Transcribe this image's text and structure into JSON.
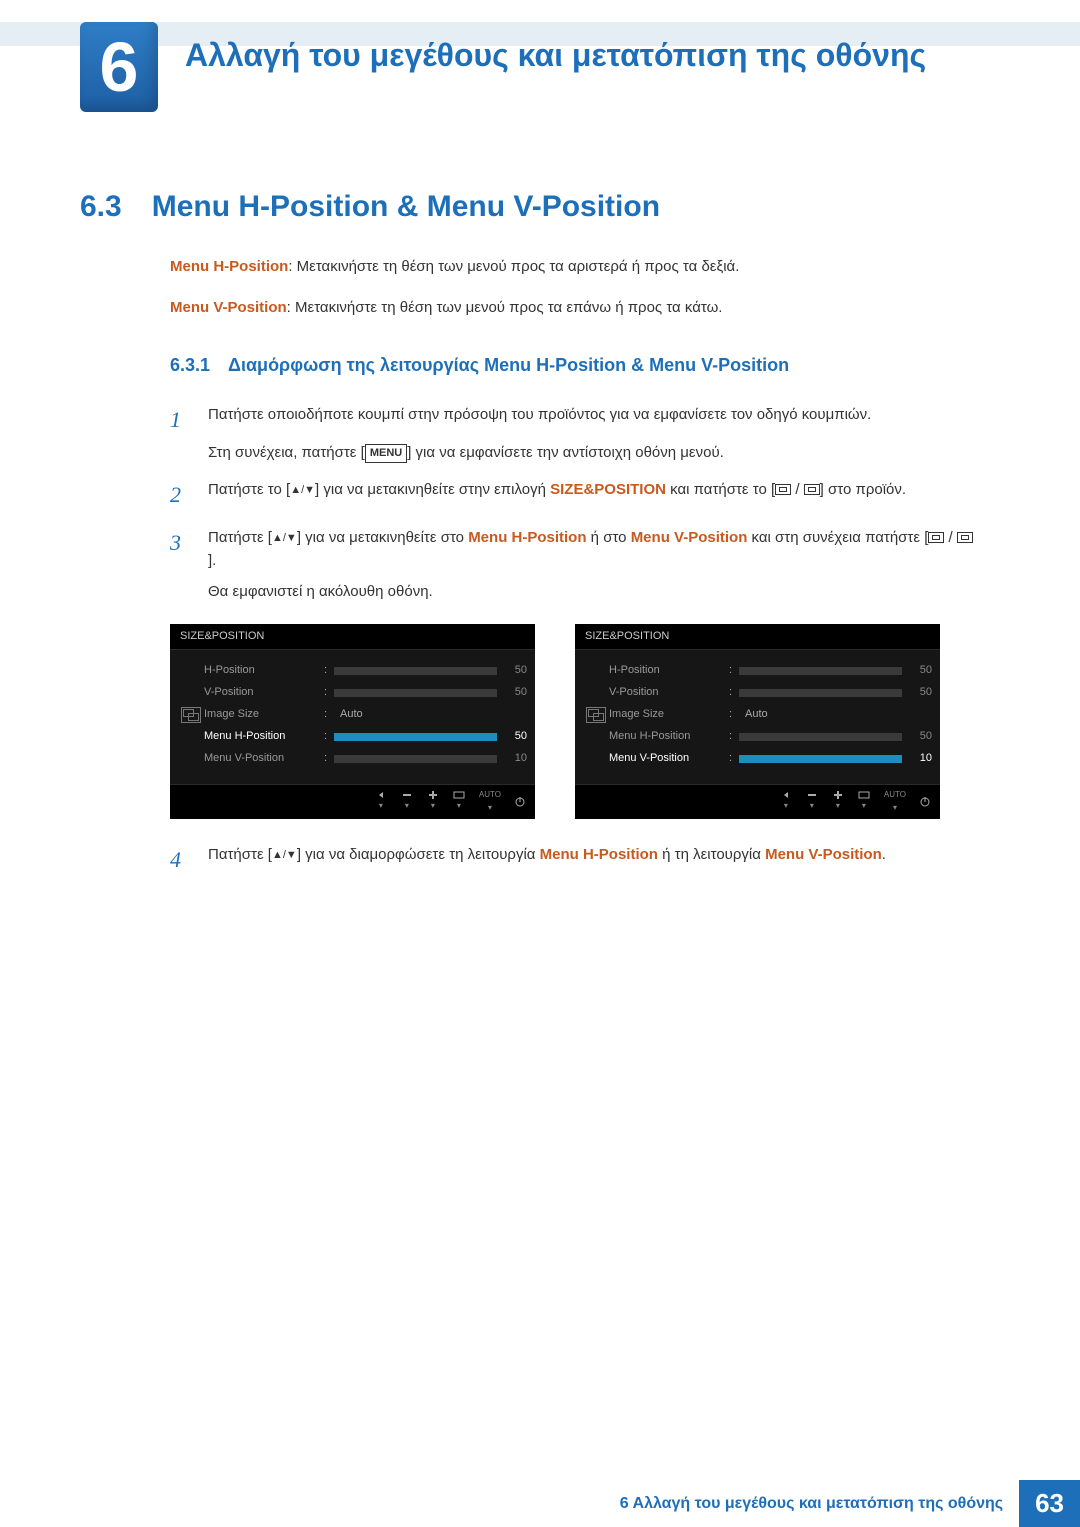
{
  "chapter": {
    "number": "6",
    "title": "Αλλαγή του μεγέθους και μετατόπιση της οθόνης"
  },
  "section": {
    "number": "6.3",
    "title": "Menu H-Position & Menu V-Position"
  },
  "definitions": [
    {
      "term": "Menu H-Position",
      "desc": ": Μετακινήστε τη θέση των μενού προς τα αριστερά ή προς τα δεξιά."
    },
    {
      "term": "Menu V-Position",
      "desc": ": Μετακινήστε τη θέση των μενού προς τα επάνω ή προς τα κάτω."
    }
  ],
  "subsection": {
    "number": "6.3.1",
    "title": "Διαμόρφωση της λειτουργίας Menu H-Position & Menu V-Position"
  },
  "steps": {
    "s1": {
      "num": "1",
      "p1": "Πατήστε οποιοδήποτε κουμπί στην πρόσοψη του προϊόντος για να εμφανίσετε τον οδηγό κουμπιών.",
      "p2a": "Στη συνέχεια, πατήστε [",
      "menu_key": "MENU",
      "p2b": "] για να εμφανίσετε την αντίστοιχη οθόνη μενού."
    },
    "s2": {
      "num": "2",
      "a": "Πατήστε το [",
      "b": "] για να μετακινηθείτε στην επιλογή ",
      "hl": "SIZE&POSITION",
      "c": " και πατήστε το [",
      "d": "] στο προϊόν."
    },
    "s3": {
      "num": "3",
      "a": "Πατήστε [",
      "b": "] για να μετακινηθείτε στο ",
      "hl1": "Menu H-Position",
      "mid": " ή στο ",
      "hl2": "Menu V-Position",
      "c": " και στη συνέχεια πατήστε [",
      "d": "].",
      "after": "Θα εμφανιστεί η ακόλουθη οθόνη."
    },
    "s4": {
      "num": "4",
      "a": "Πατήστε [",
      "b": "] για να διαμορφώσετε τη λειτουργία ",
      "hl1": "Menu H-Position",
      "mid": " ή τη λειτουργία ",
      "hl2": "Menu V-Position",
      "c": "."
    }
  },
  "osd": {
    "title": "SIZE&POSITION",
    "items": [
      {
        "label": "H-Position",
        "val": "50"
      },
      {
        "label": "V-Position",
        "val": "50"
      },
      {
        "label": "Image Size",
        "val": "Auto"
      },
      {
        "label": "Menu H-Position",
        "val": "50"
      },
      {
        "label": "Menu V-Position",
        "val": "10"
      }
    ],
    "buttons": {
      "auto": "AUTO"
    },
    "panel1_selected": 3,
    "panel2_selected": 4
  },
  "footer": {
    "text": "6 Αλλαγή του μεγέθους και μετατόπιση της οθόνης",
    "page": "63"
  }
}
